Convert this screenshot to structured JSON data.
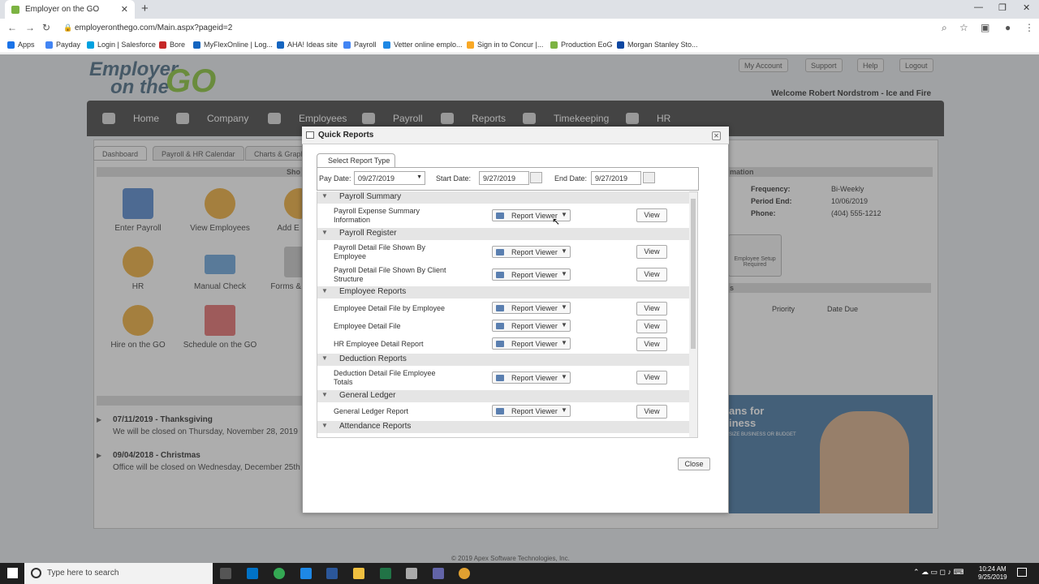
{
  "browser": {
    "tab_title": "Employer on the GO",
    "url": "employeronthego.com/Main.aspx?pageid=2",
    "bookmarks": [
      "Apps",
      "Payday",
      "Login | Salesforce",
      "Bore",
      "MyFlexOnline | Log...",
      "AHA! Ideas site",
      "Payroll",
      "Vetter online emplo...",
      "Sign in to Concur |...",
      "Production EoG",
      "Morgan Stanley Sto..."
    ]
  },
  "logo": {
    "line1": "Employer",
    "line2": "on the",
    "go": "GO"
  },
  "top_links": [
    "My Account",
    "Support",
    "Help",
    "Logout"
  ],
  "welcome": "Welcome Robert Nordstrom - Ice and Fire",
  "nav": [
    "Home",
    "Company",
    "Employees",
    "Payroll",
    "Reports",
    "Timekeeping",
    "HR"
  ],
  "page_tabs": [
    "Dashboard",
    "Payroll & HR Calendar",
    "Charts & Graphs"
  ],
  "shortcuts_header": "Sho",
  "tiles": [
    "Enter Payroll",
    "View Employees",
    "Add E",
    "HR",
    "Manual Check",
    "Forms & I",
    "Hire on the GO",
    "Schedule on the GO"
  ],
  "holidays": [
    {
      "title": "07/11/2019 - Thanksgiving",
      "desc": "We will be closed on Thursday, November 28, 2019"
    },
    {
      "title": "09/04/2018 - Christmas",
      "desc": "Office will be closed on Wednesday, December 25th"
    }
  ],
  "info": {
    "header": "mation",
    "frequency_label": "Frequency:",
    "frequency": "Bi-Weekly",
    "period_label": "Period End:",
    "period": "10/06/2019",
    "phone_label": "Phone:",
    "phone": "(404) 555-1212",
    "setup_label": "Employee Setup Required",
    "tasks_header": "s",
    "priority": "Priority",
    "due": "Date Due"
  },
  "banner": {
    "line1": "ans for",
    "line2": "iness",
    "line3": "SIZE BUSINESS OR BUDGET"
  },
  "footer": "© 2019 Apex Software Technologies, Inc.",
  "modal": {
    "title": "Quick Reports",
    "tab": "Select Report Type",
    "pay_date_label": "Pay Date:",
    "pay_date": "09/27/2019",
    "start_label": "Start Date:",
    "start_date": "9/27/2019",
    "end_label": "End Date:",
    "end_date": "9/27/2019",
    "viewer": "Report Viewer",
    "view": "View",
    "close": "Close",
    "groups": [
      {
        "name": "Payroll Summary",
        "reports": [
          "Payroll Expense Summary Information"
        ]
      },
      {
        "name": "Payroll Register",
        "reports": [
          "Payroll Detail File Shown By Employee",
          "Payroll Detail File Shown By Client Structure"
        ]
      },
      {
        "name": "Employee Reports",
        "reports": [
          "Employee Detail File by Employee",
          "Employee Detail File",
          "HR Employee Detail Report"
        ]
      },
      {
        "name": "Deduction Reports",
        "reports": [
          "Deduction Detail File Employee Totals"
        ]
      },
      {
        "name": "General Ledger",
        "reports": [
          "General Ledger Report"
        ]
      },
      {
        "name": "Attendance Reports",
        "reports": []
      }
    ]
  },
  "taskbar": {
    "search": "Type here to search",
    "time": "10:24 AM",
    "date": "9/25/2019"
  }
}
